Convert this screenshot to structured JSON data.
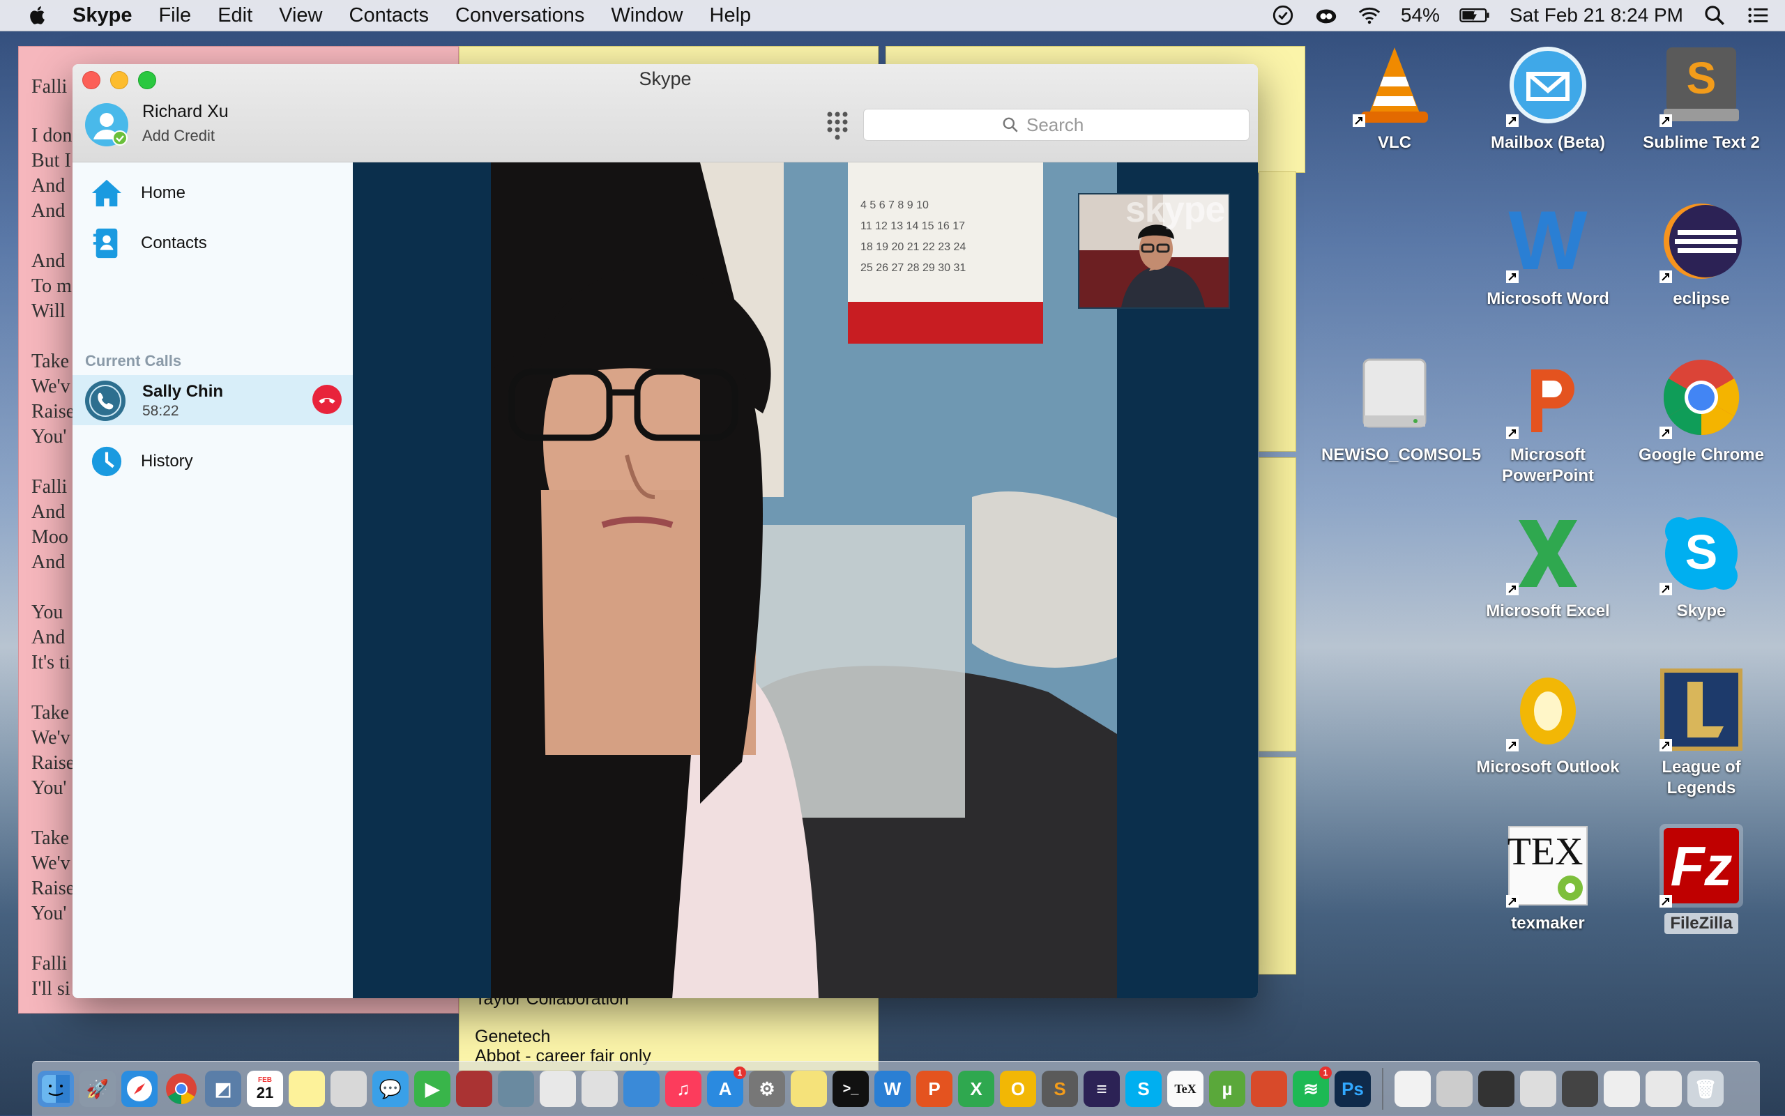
{
  "menubar": {
    "app_name": "Skype",
    "items": [
      "File",
      "Edit",
      "View",
      "Contacts",
      "Conversations",
      "Window",
      "Help"
    ],
    "battery": "54%",
    "datetime": "Sat Feb 21  8:24 PM"
  },
  "window": {
    "title": "Skype"
  },
  "profile": {
    "name": "Richard Xu",
    "credit_link": "Add Credit"
  },
  "search": {
    "placeholder": "Search"
  },
  "sidebar": {
    "home": "Home",
    "contacts": "Contacts",
    "current_calls_header": "Current Calls",
    "call": {
      "name": "Sally Chin",
      "duration": "58:22"
    },
    "history": "History"
  },
  "video": {
    "watermark": "skype"
  },
  "notes": {
    "pink_lines": [
      "Falli",
      "I don",
      "But I",
      "And",
      "And",
      "And",
      "To m",
      "Will",
      "Take",
      "We'v",
      "Raise",
      "You'",
      "Falli",
      "And",
      "Moo",
      "And",
      "You",
      "And",
      "It's ti",
      "Take",
      "We'v",
      "Raise",
      "You'",
      "Take",
      "We'v",
      "Raise",
      "You'",
      "Falli",
      "I'll si"
    ],
    "yellow_lines": [
      "Taylor Collaboration",
      "Genetech",
      "Abbot - career fair only"
    ]
  },
  "desktop_icons": [
    {
      "label": "VLC",
      "icon": "vlc-cone-icon"
    },
    {
      "label": "Mailbox (Beta)",
      "icon": "mailbox-icon"
    },
    {
      "label": "Sublime Text 2",
      "icon": "sublime-icon"
    },
    {
      "label": "Microsoft Word",
      "icon": "word-icon"
    },
    {
      "label": "eclipse",
      "icon": "eclipse-icon"
    },
    {
      "label": "NEWiSO_COMSOL5",
      "icon": "drive-icon"
    },
    {
      "label": "Microsoft PowerPoint",
      "icon": "powerpoint-icon"
    },
    {
      "label": "Google Chrome",
      "icon": "chrome-icon"
    },
    {
      "label": "Microsoft Excel",
      "icon": "excel-icon"
    },
    {
      "label": "Skype",
      "icon": "skype-icon"
    },
    {
      "label": "Microsoft Outlook",
      "icon": "outlook-icon"
    },
    {
      "label": "League of Legends",
      "icon": "league-icon"
    },
    {
      "label": "texmaker",
      "icon": "texmaker-icon"
    },
    {
      "label": "FileZilla",
      "icon": "filezilla-icon"
    }
  ],
  "dock": {
    "calendar_date": "21",
    "calendar_month": "FEB",
    "tex_label": "TeX",
    "ps_label": "Ps",
    "badges": [
      "1",
      "1"
    ]
  },
  "colors": {
    "skype_blue": "#00aff0",
    "hangup_red": "#e8233b",
    "selected_row": "#d8eef9"
  }
}
